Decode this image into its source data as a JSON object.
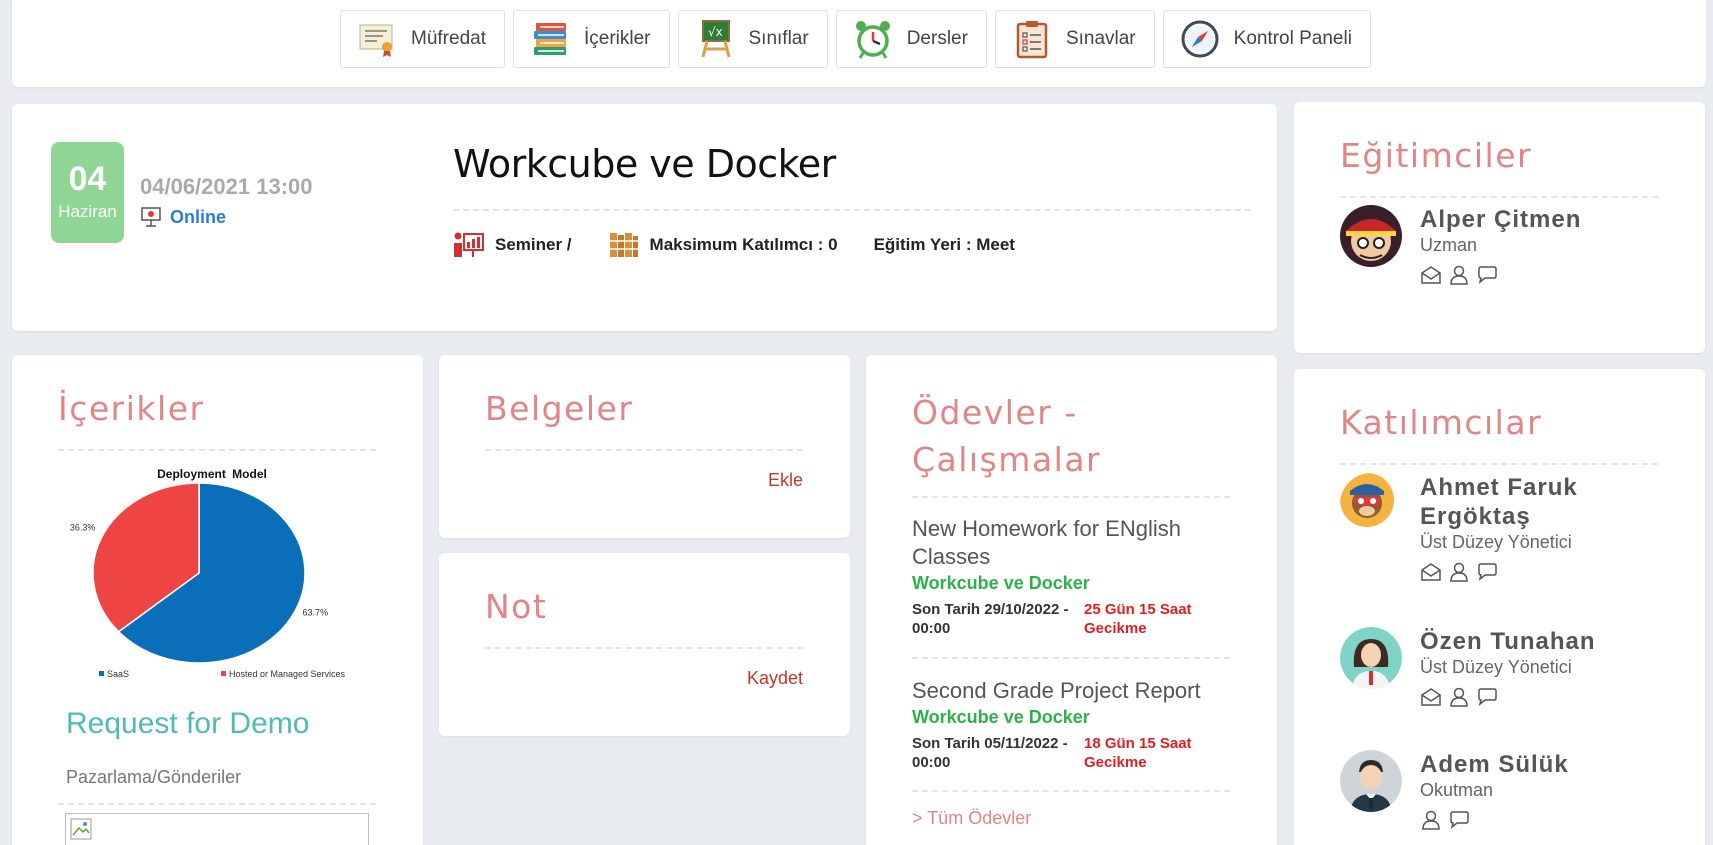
{
  "nav": [
    {
      "label": "Müfredat",
      "icon": "certificate-icon"
    },
    {
      "label": "İçerikler",
      "icon": "books-icon"
    },
    {
      "label": "Sınıflar",
      "icon": "chalkboard-icon"
    },
    {
      "label": "Dersler",
      "icon": "alarm-clock-icon"
    },
    {
      "label": "Sınavlar",
      "icon": "clipboard-icon"
    },
    {
      "label": "Kontrol Paneli",
      "icon": "compass-icon"
    }
  ],
  "event": {
    "day": "04",
    "month": "Haziran",
    "datetime": "04/06/2021 13:00",
    "mode": "Online",
    "title": "Workcube ve Docker",
    "type": "Seminer /",
    "max_participants": "Maksimum Katılımcı : 0",
    "location": "Eğitim Yeri : Meet"
  },
  "trainers": {
    "title": "Eğitimciler",
    "people": [
      {
        "name": "Alper Çitmen",
        "role": "Uzman"
      }
    ]
  },
  "participants": {
    "title": "Katılımcılar",
    "people": [
      {
        "name_line1": "Ahmet Faruk",
        "name_line2": "Ergöktaş",
        "role": "Üst Düzey Yönetici"
      },
      {
        "name": "Özen Tunahan",
        "role": "Üst Düzey Yönetici"
      },
      {
        "name": "Adem Sülük",
        "role": "Okutman"
      }
    ]
  },
  "contents": {
    "title": "İçerikler",
    "demo_link": "Request for Demo",
    "category": "Pazarlama/Gönderiler"
  },
  "documents": {
    "title": "Belgeler",
    "add": "Ekle"
  },
  "note": {
    "title": "Not",
    "save": "Kaydet"
  },
  "homework": {
    "title_line1": "Ödevler -",
    "title_line2": "Çalışmalar",
    "items": [
      {
        "title_line1": "New Homework for ENglish",
        "title_line2": "Classes",
        "course": "Workcube ve Docker",
        "deadline_line1": "Son Tarih 29/10/2022 -",
        "deadline_line2": "00:00",
        "delay_line1": "25 Gün 15 Saat",
        "delay_line2": "Gecikme"
      },
      {
        "title_line1": "Second Grade Project Report",
        "course": "Workcube ve Docker",
        "deadline_line1": "Son Tarih 05/11/2022 -",
        "deadline_line2": "00:00",
        "delay_line1": "18 Gün 15 Saat",
        "delay_line2": "Gecikme"
      }
    ],
    "all_link": "> Tüm Ödevler"
  },
  "chart_data": {
    "type": "pie",
    "title_highlight": "Deployment",
    "title_rest": "Model",
    "series": [
      {
        "name": "SaaS",
        "value": 63.7,
        "label": "63.7%",
        "color": "#0a6fb8"
      },
      {
        "name": "Hosted or Managed Services",
        "value": 36.3,
        "label": "36.3%",
        "color": "#ef4444"
      }
    ]
  }
}
